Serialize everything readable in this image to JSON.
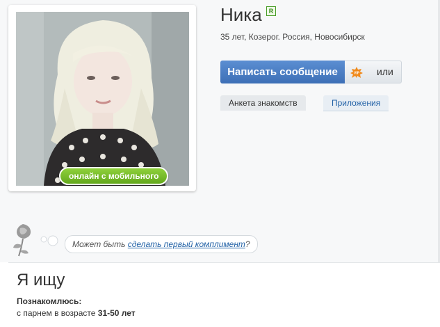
{
  "profile": {
    "name": "Ника",
    "registered_badge": "R",
    "details": "35 лет, Козерог. Россия, Новосибирск",
    "online_badge": "онлайн с мобильного"
  },
  "actions": {
    "message_button": "Написать сообщение",
    "vip_icon_label": "VIP",
    "or_label": "или"
  },
  "tabs": [
    {
      "label": "Анкета знакомств"
    },
    {
      "label": "Приложения"
    }
  ],
  "compliment": {
    "prefix": "Может быть ",
    "link": "сделать первый комплимент",
    "suffix": "?"
  },
  "seeking": {
    "title": "Я ищу",
    "label": "Познакомлюсь:",
    "text_prefix": "с парнем в возрасте ",
    "age_range": "31-50 лет"
  },
  "colors": {
    "accent_blue": "#3d6fb6",
    "online_green": "#63a81c",
    "link_blue": "#2463a7"
  }
}
